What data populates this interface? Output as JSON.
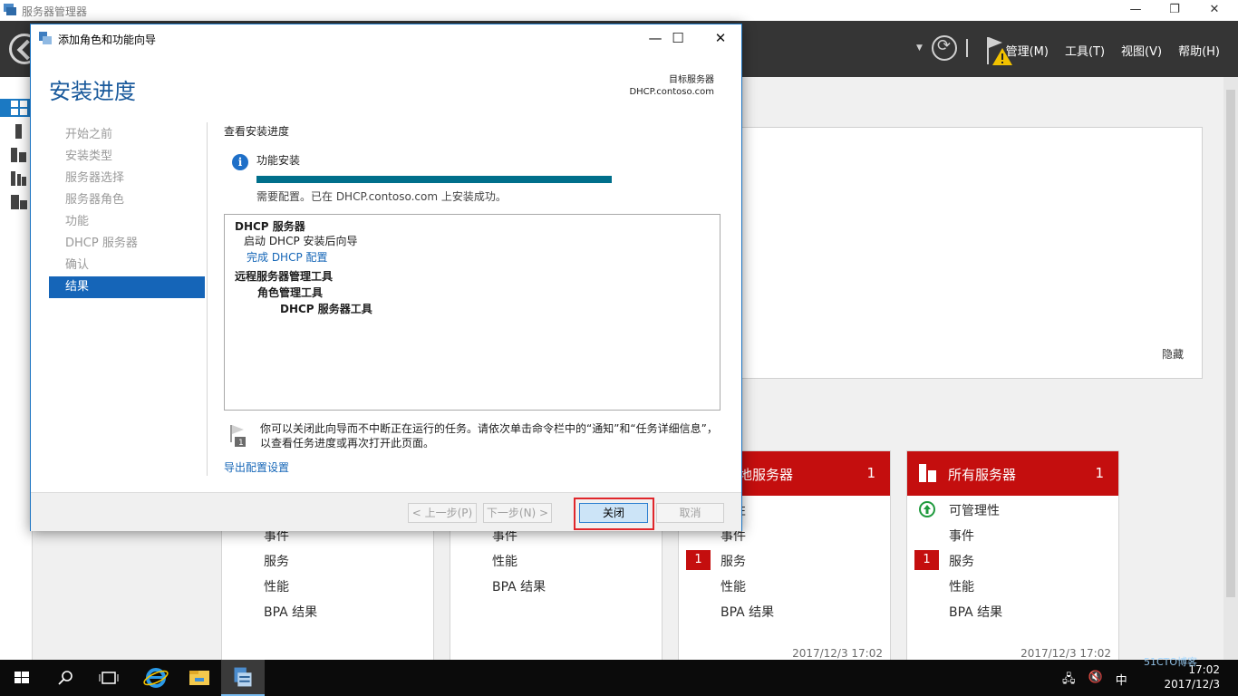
{
  "server_manager": {
    "title": "服务器管理器",
    "menus": [
      "管理(M)",
      "工具(T)",
      "视图(V)",
      "帮助(H)"
    ],
    "welcome_hide": "隐藏",
    "tiles": [
      {
        "name": "本地服务器",
        "name_visible": "地服务器",
        "count": "1",
        "rows": [
          "可管理性",
          "事件",
          "服务",
          "性能",
          "BPA 结果"
        ],
        "rows_visible": [
          "理性",
          "事件",
          "服务",
          "性能",
          "BPA 结果"
        ],
        "service_badge": "1",
        "timestamp": "2017/12/3 17:02"
      },
      {
        "name": "所有服务器",
        "count": "1",
        "rows": [
          "可管理性",
          "事件",
          "服务",
          "性能",
          "BPA 结果"
        ],
        "service_badge": "1",
        "timestamp": "2017/12/3 17:02"
      }
    ],
    "partial_tiles": [
      {
        "rows": [
          "事件",
          "服务",
          "性能",
          "BPA 结果"
        ]
      },
      {
        "rows": [
          "事件",
          "性能",
          "BPA 结果"
        ]
      }
    ]
  },
  "wizard": {
    "window_title": "添加角色和功能向导",
    "heading": "安装进度",
    "target_label": "目标服务器",
    "target_server": "DHCP.contoso.com",
    "steps": [
      {
        "label": "开始之前",
        "current": false
      },
      {
        "label": "安装类型",
        "current": false
      },
      {
        "label": "服务器选择",
        "current": false
      },
      {
        "label": "服务器角色",
        "current": false
      },
      {
        "label": "功能",
        "current": false
      },
      {
        "label": "DHCP 服务器",
        "current": false
      },
      {
        "label": "确认",
        "current": false
      },
      {
        "label": "结果",
        "current": true
      }
    ],
    "section_title": "查看安装进度",
    "feature_label": "功能安装",
    "progress_percent": 100,
    "status_text": "需要配置。已在 DHCP.contoso.com 上安装成功。",
    "results": {
      "role": "DHCP 服务器",
      "post_task": "启动 DHCP 安装后向导",
      "post_task_link": "完成 DHCP 配置",
      "tools_group": "远程服务器管理工具",
      "tools_sub": "角色管理工具",
      "tools_item": "DHCP 服务器工具"
    },
    "note": "你可以关闭此向导而不中断正在运行的任务。请依次单击命令栏中的“通知”和“任务详细信息”，以查看任务进度或再次打开此页面。",
    "export_link": "导出配置设置",
    "buttons": {
      "back": "< 上一步(P)",
      "next": "下一步(N) >",
      "close": "关闭",
      "cancel": "取消"
    }
  },
  "taskbar": {
    "ime": "中",
    "clock_time": "17:02",
    "clock_date": "2017/12/3",
    "watermark": "51CTO博客"
  },
  "colors": {
    "accent": "#1565b8",
    "tile_red": "#c40e0e",
    "progress": "#006f8b",
    "highlight": "#e0262b"
  }
}
